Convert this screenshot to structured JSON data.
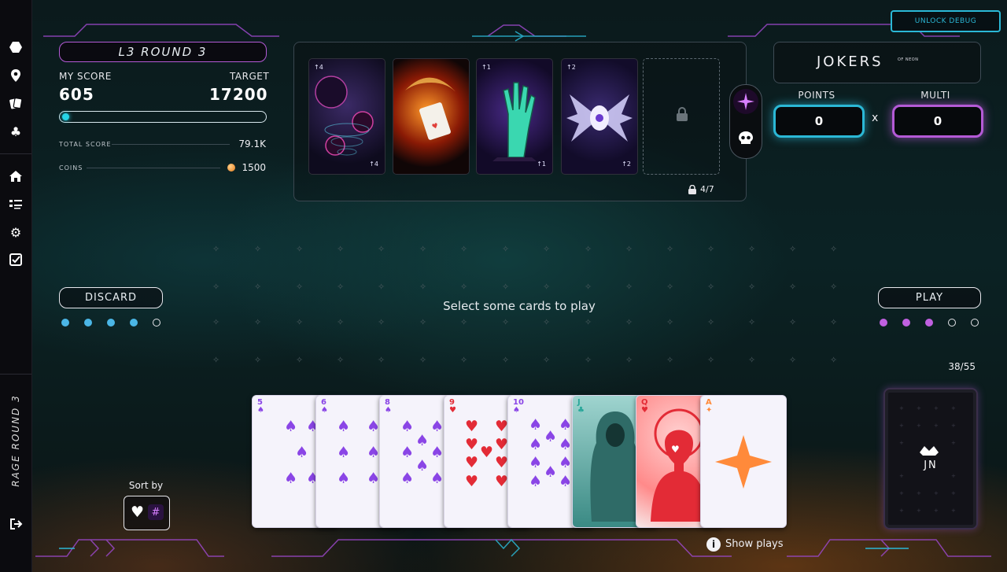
{
  "app": {
    "level_label": "L3 ROUND 3",
    "unlock_debug_label": "UNLOCK DEBUG",
    "vertical_label": "RAGE ROUND 3"
  },
  "sidebar": {
    "icons": [
      "hex-icon",
      "map-pin-icon",
      "cards-icon",
      "club-icon",
      "home-icon",
      "list-icon",
      "gear-icon",
      "checkbox-icon",
      "logout-icon"
    ]
  },
  "score": {
    "my_score_label": "MY SCORE",
    "my_score": "605",
    "target_label": "TARGET",
    "target": "17200",
    "progress": 0.035,
    "total_score_label": "TOTAL SCORE",
    "total_score": "79.1K",
    "coins_label": "COINS",
    "coins": "1500"
  },
  "jokers": {
    "cards": [
      {
        "name": "planets-joker",
        "tag_top": "↑4",
        "tag_bottom": "↑4"
      },
      {
        "name": "fire-card-joker",
        "tag_top": "",
        "tag_bottom": ""
      },
      {
        "name": "zombie-hand-joker",
        "tag_top": "↑1",
        "tag_bottom": "↑1"
      },
      {
        "name": "winged-eye-joker",
        "tag_top": "↑2",
        "tag_bottom": "↑2"
      }
    ],
    "slots_label": "4/7"
  },
  "logo": {
    "title": "JOKERS",
    "subtitle": "OF NEON"
  },
  "points": {
    "label": "POINTS",
    "value": "0"
  },
  "multi": {
    "label": "MULTI",
    "value": "0",
    "separator": "x"
  },
  "actions": {
    "discard_label": "DISCARD",
    "play_label": "PLAY",
    "prompt": "Select some cards to play",
    "discard_dots": [
      true,
      true,
      true,
      true,
      false
    ],
    "play_dots": [
      true,
      true,
      true,
      false,
      false
    ]
  },
  "deck": {
    "count": "38/55",
    "logo_text": "JN"
  },
  "sort": {
    "label": "Sort by",
    "suit_symbol": "♥",
    "rank_symbol": "#"
  },
  "hand": {
    "cards": [
      {
        "rank": "5",
        "suit": "♠"
      },
      {
        "rank": "6",
        "suit": "♠"
      },
      {
        "rank": "8",
        "suit": "♠"
      },
      {
        "rank": "9",
        "suit": "♥"
      },
      {
        "rank": "10",
        "suit": "♠"
      },
      {
        "rank": "J",
        "suit": "♣"
      },
      {
        "rank": "Q",
        "suit": "♥"
      },
      {
        "rank": "A",
        "suit": "✦"
      }
    ]
  },
  "footer": {
    "show_plays_label": "Show plays"
  },
  "colors": {
    "cyan": "#2bb8d6",
    "purple": "#b45ad6",
    "card_purple": "#8a45e6",
    "card_red": "#e32b36",
    "card_teal": "#2aa79a",
    "card_orange": "#ff8a3a"
  }
}
